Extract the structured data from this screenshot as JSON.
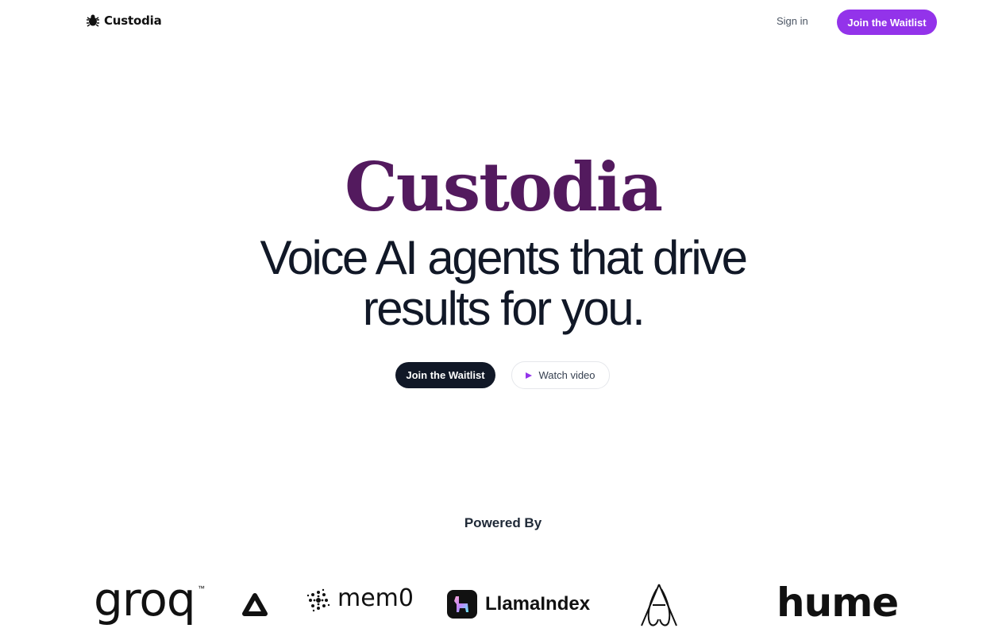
{
  "nav": {
    "brand": "Custodia",
    "brand_icon": "bug-icon",
    "signin": "Sign in",
    "cta": "Join the Waitlist"
  },
  "hero": {
    "title": "Custodia",
    "subtitle_line1": "Voice AI agents that drive",
    "subtitle_line2": "results for you.",
    "primary_cta": "Join the Waitlist",
    "video_cta": "Watch video",
    "video_icon": "play-icon"
  },
  "powered": {
    "heading": "Powered By",
    "logos": {
      "groq": "groq",
      "groq_mark": "™",
      "memo": "mem0",
      "llama": "LlamaIndex",
      "hume": "hume"
    }
  },
  "colors": {
    "accent": "#9333ea",
    "title": "#531a5e",
    "dark": "#111827"
  }
}
